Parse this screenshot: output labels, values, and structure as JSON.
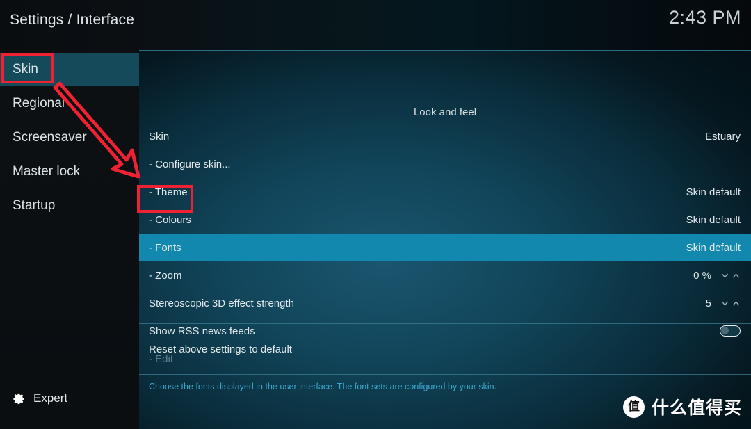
{
  "header": {
    "title": "Settings / Interface",
    "clock": "2:43 PM"
  },
  "sidebar": {
    "items": [
      {
        "label": "Skin",
        "selected": true
      },
      {
        "label": "Regional",
        "selected": false
      },
      {
        "label": "Screensaver",
        "selected": false
      },
      {
        "label": "Master lock",
        "selected": false
      },
      {
        "label": "Startup",
        "selected": false
      }
    ],
    "level": {
      "label": "Expert",
      "icon": "gear-icon"
    }
  },
  "main": {
    "group_title": "Look and feel",
    "settings": [
      {
        "label": "Skin",
        "value": "Estuary",
        "control": "value",
        "selected": false,
        "disabled": false
      },
      {
        "label": "- Configure skin...",
        "value": "",
        "control": "none",
        "selected": false,
        "disabled": false
      },
      {
        "label": "- Theme",
        "value": "Skin default",
        "control": "value",
        "selected": false,
        "disabled": false
      },
      {
        "label": "- Colours",
        "value": "Skin default",
        "control": "value",
        "selected": false,
        "disabled": false
      },
      {
        "label": "- Fonts",
        "value": "Skin default",
        "control": "value",
        "selected": true,
        "disabled": false
      },
      {
        "label": "- Zoom",
        "value": "0 %",
        "control": "spinner",
        "selected": false,
        "disabled": false
      },
      {
        "label": "Stereoscopic 3D effect strength",
        "value": "5",
        "control": "spinner",
        "selected": false,
        "disabled": false
      },
      {
        "label": "Show RSS news feeds",
        "value": "",
        "control": "toggle",
        "toggle_state": "off",
        "selected": false,
        "disabled": false
      },
      {
        "label": "- Edit",
        "value": "",
        "control": "none",
        "selected": false,
        "disabled": true
      }
    ],
    "reset": {
      "label": "Reset above settings to default"
    },
    "help_text": "Choose the fonts displayed in the user interface. The font sets are configured by your skin."
  },
  "watermark": {
    "badge": "值",
    "text": "什么值得买"
  },
  "annotations": {
    "color": "#ee2233",
    "highlight_skin": "Skin",
    "highlight_fonts": "- Fonts",
    "arrow": "arrow-skin-to-fonts"
  },
  "colors": {
    "accent_highlight": "#1288ae",
    "sidebar_selected": "#154a5b",
    "help_text": "#3ba6cd",
    "annotation_red": "#ee2233"
  }
}
